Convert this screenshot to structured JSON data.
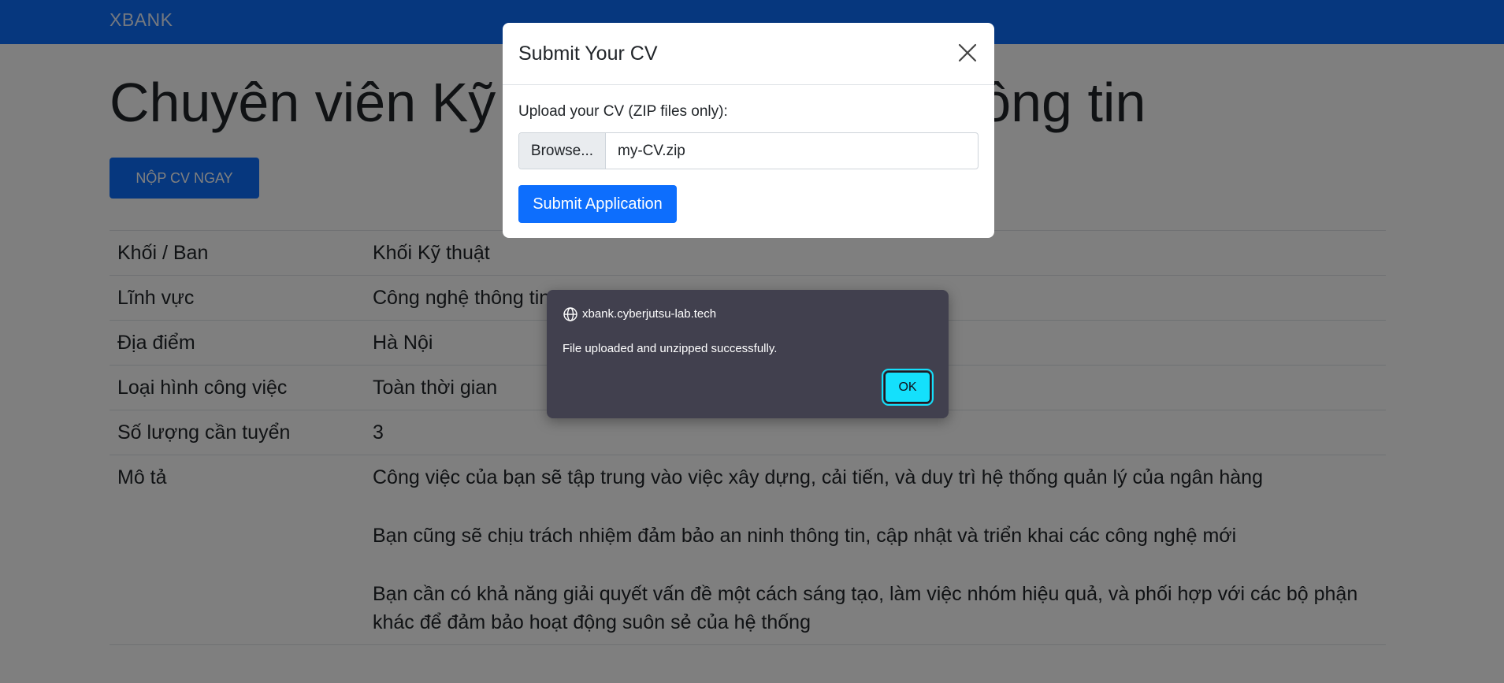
{
  "navbar": {
    "brand": "XBANK"
  },
  "page": {
    "title": "Chuyên viên Kỹ thuật Công nghệ thông tin"
  },
  "apply_button_label": "NỘP CV NGAY",
  "job_details": [
    {
      "label": "Khối / Ban",
      "value": "Khối Kỹ thuật"
    },
    {
      "label": "Lĩnh vực",
      "value": "Công nghệ thông tin"
    },
    {
      "label": "Địa điểm",
      "value": "Hà Nội"
    },
    {
      "label": "Loại hình công việc",
      "value": "Toàn thời gian"
    },
    {
      "label": "Số lượng cần tuyển",
      "value": "3"
    }
  ],
  "description": {
    "label": "Mô tả",
    "paragraphs": [
      "Công việc của bạn sẽ tập trung vào việc xây dựng, cải tiến, và duy trì hệ thống quản lý của ngân hàng",
      "Bạn cũng sẽ chịu trách nhiệm đảm bảo an ninh thông tin, cập nhật và triển khai các công nghệ mới",
      "Bạn cần có khả năng giải quyết vấn đề một cách sáng tạo, làm việc nhóm hiệu quả, và phối hợp với các bộ phận khác để đảm bảo hoạt động suôn sẻ của hệ thống"
    ]
  },
  "cv_modal": {
    "title": "Submit Your CV",
    "upload_label": "Upload your CV (ZIP files only):",
    "browse_label": "Browse...",
    "file_name": "my-CV.zip",
    "submit_label": "Submit Application"
  },
  "alert": {
    "origin": "xbank.cyberjutsu-lab.tech",
    "message": "File uploaded and unzipped successfully.",
    "ok_label": "OK"
  },
  "colors": {
    "primary": "#0d6efd",
    "alert_bg": "#41404e",
    "ok_accent": "#14e0fc"
  }
}
